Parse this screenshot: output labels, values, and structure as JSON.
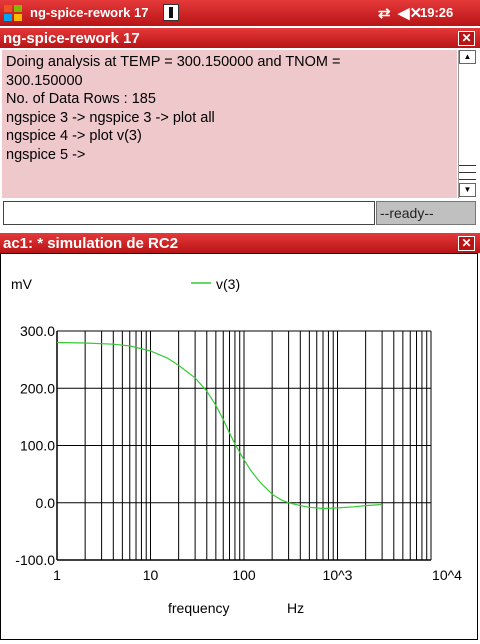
{
  "taskbar": {
    "title": "ng-spice-rework 17",
    "clock": "19:26",
    "close_label": "✕"
  },
  "console_window": {
    "title": "ng-spice-rework 17",
    "close_label": "✕",
    "lines": [
      "Doing analysis at TEMP = 300.150000 and TNOM =",
      "300.150000",
      "",
      "No. of Data Rows : 185",
      "ngspice 3 -> ngspice 3 -> plot all",
      "ngspice 4 -> plot v(3)",
      "ngspice 5 ->"
    ],
    "input_value": "",
    "status": "--ready--"
  },
  "plot_window": {
    "title": "ac1: * simulation de RC2",
    "close_label": "✕"
  },
  "chart_data": {
    "type": "line",
    "ylabel": "mV",
    "xlabel": "frequency",
    "xunit": "Hz",
    "xscale": "log",
    "xlim": [
      1,
      10000
    ],
    "ylim": [
      -100,
      300
    ],
    "xticks": [
      "1",
      "10",
      "100",
      "10^3",
      "10^4"
    ],
    "yticks": [
      "300.0",
      "200.0",
      "100.0",
      "0.0",
      "-100.0"
    ],
    "grid": true,
    "legend_position": "top",
    "colors": {
      "series": "#33cc33",
      "grid": "#000000",
      "axes": "#000000"
    },
    "series": [
      {
        "name": "v(3)",
        "x": [
          1,
          2,
          4,
          6,
          10,
          15,
          20,
          30,
          40,
          50,
          60,
          70,
          80,
          100,
          120,
          150,
          200,
          250,
          300,
          400,
          500,
          700,
          1000,
          1500,
          2000,
          3000
        ],
        "y": [
          280,
          279,
          277,
          274,
          265,
          253,
          240,
          218,
          195,
          170,
          145,
          122,
          103,
          75,
          55,
          35,
          15,
          5,
          0,
          -5,
          -8,
          -10,
          -9,
          -7,
          -5,
          -3
        ]
      }
    ]
  }
}
